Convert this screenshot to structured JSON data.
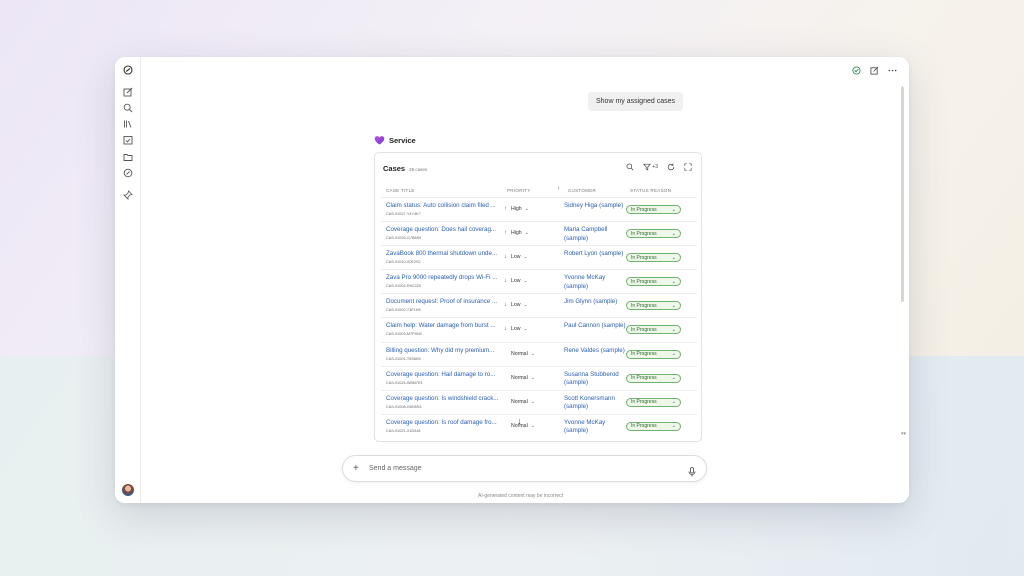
{
  "user_message": "Show my assigned cases",
  "agent": {
    "name": "Service"
  },
  "cases_card": {
    "title": "Cases",
    "count": "25 cases",
    "filter_count": "+3",
    "columns": [
      "CASE TITLE",
      "PRIORITY",
      "CUSTOMER",
      "STATUS REASON"
    ],
    "rows": [
      {
        "title": "Claim status: Auto collision claim filed ...",
        "id": "CAS-01027-Y4Y4K7",
        "priority": "High",
        "priority_icon": "up-arrow",
        "customer": "Sidney Higa (sample)",
        "status": "In Progress"
      },
      {
        "title": "Coverage question: Does hail coverag...",
        "id": "CAS-01026-G7B8S9",
        "priority": "High",
        "priority_icon": "up-arrow",
        "customer": "Maria Campbell (sample)",
        "status": "In Progress"
      },
      {
        "title": "ZavaBook 800 thermal shutdown unde...",
        "id": "CAS-01010-X0F2S2",
        "priority": "Low",
        "priority_icon": "down-arrow",
        "customer": "Robert Lyon (sample)",
        "status": "In Progress"
      },
      {
        "title": "Zava Pro 9000 repeatedly drops Wi-Fi ...",
        "id": "CAS-01004-R6C2Z0",
        "priority": "Low",
        "priority_icon": "down-arrow",
        "customer": "Yvonne McKay (sample)",
        "status": "In Progress"
      },
      {
        "title": "Document request: Proof of insurance ...",
        "id": "CAS-01002-T3F1H5",
        "priority": "Low",
        "priority_icon": "down-arrow",
        "customer": "Jim Glynn (sample)",
        "status": "In Progress"
      },
      {
        "title": "Claim help: Water damage from burst ...",
        "id": "CAS-01003-M7P9N3",
        "priority": "Low",
        "priority_icon": "down-arrow",
        "customer": "Paul Cannon (sample)",
        "status": "In Progress"
      },
      {
        "title": "Billing question: Why did my premium...",
        "id": "CAS-01001-T5S6K6",
        "priority": "Normal",
        "priority_icon": "",
        "customer": "Rene Valdes (sample)",
        "status": "In Progress"
      },
      {
        "title": "Coverage question: Hail damage to ro...",
        "id": "CAS-01024-W8M7R1",
        "priority": "Normal",
        "priority_icon": "",
        "customer": "Susanna Stubberod (sample)",
        "status": "In Progress"
      },
      {
        "title": "Coverage question: Is windshield crack...",
        "id": "CAS-01008-G6N5S3",
        "priority": "Normal",
        "priority_icon": "",
        "customer": "Scott Konersmann (sample)",
        "status": "In Progress"
      },
      {
        "title": "Coverage question: Is roof damage fro...",
        "id": "CAS-01021-X1D5J8",
        "priority": "Normal",
        "priority_icon": "",
        "customer": "Yvonne McKay (sample)",
        "status": "In Progress"
      }
    ]
  },
  "composer": {
    "placeholder": "Send a message"
  },
  "disclaimer": "AI-generated content may be incorrect",
  "colors": {
    "link": "#2a5fb4",
    "status_border": "#6fb36f",
    "status_bg": "#eef7ea",
    "high_arrow": "#d13438"
  }
}
